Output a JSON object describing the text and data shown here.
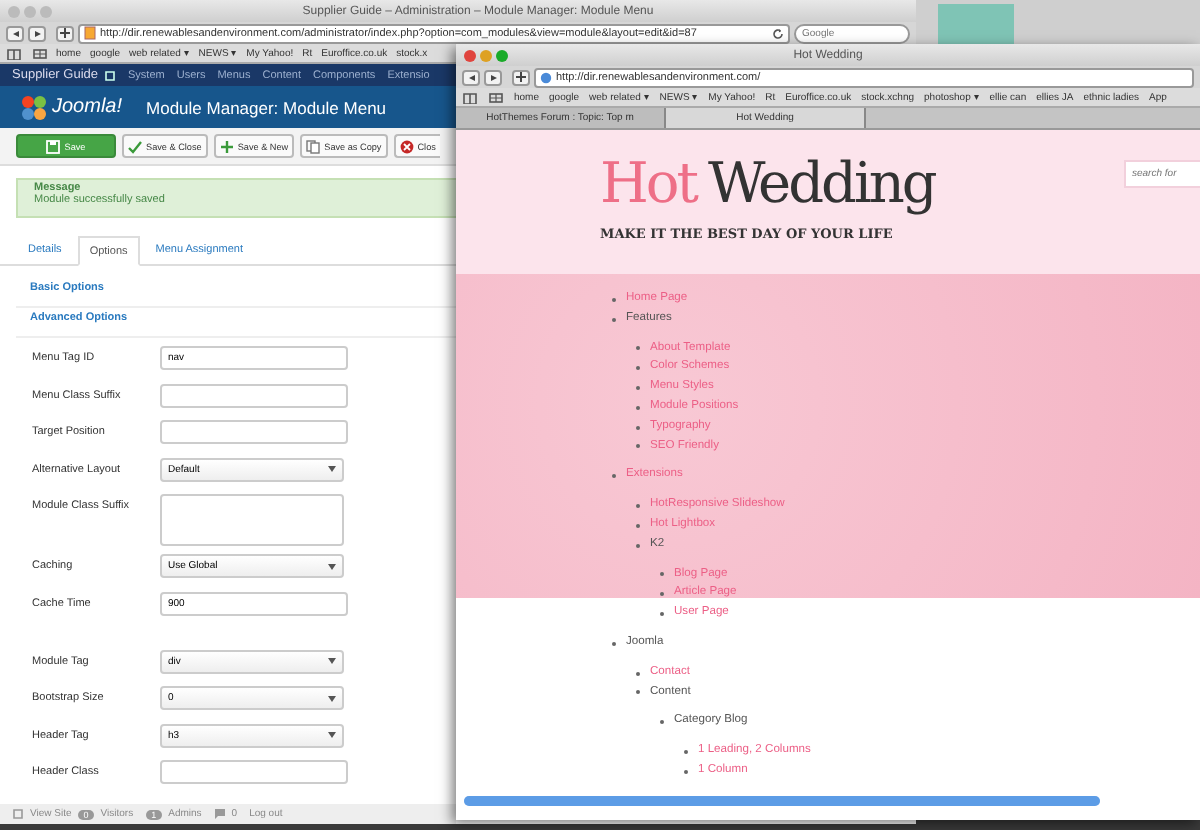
{
  "back_window": {
    "title": "Supplier Guide – Administration – Module Manager: Module Menu",
    "url": "http://dir.renewablesandenvironment.com/administrator/index.php?option=com_modules&view=module&layout=edit&id=87",
    "search_placeholder": "Google",
    "bookmarks": [
      "home",
      "google",
      "web related ▾",
      "NEWS ▾",
      "My Yahoo!",
      "Rt",
      "Euroffice.co.uk",
      "stock.x"
    ],
    "admin_nav": {
      "site": "Supplier Guide",
      "items": [
        "System",
        "Users",
        "Menus",
        "Content",
        "Components",
        "Extensio"
      ]
    },
    "header": {
      "title": "Module Manager: Module Menu",
      "logo": "Joomla!"
    },
    "toolbar": [
      {
        "label": "Save",
        "kind": "primary"
      },
      {
        "label": "Save & Close",
        "kind": "check"
      },
      {
        "label": "Save & New",
        "kind": "plus"
      },
      {
        "label": "Save as Copy",
        "kind": "copy"
      },
      {
        "label": "Clos",
        "kind": "close"
      }
    ],
    "message": {
      "title": "Message",
      "text": "Module successfully saved"
    },
    "tabs": [
      {
        "label": "Details",
        "selected": false
      },
      {
        "label": "Options",
        "selected": true
      },
      {
        "label": "Menu Assignment",
        "selected": false
      }
    ],
    "sections": [
      "Basic Options",
      "Advanced Options"
    ],
    "fields": [
      {
        "label": "Menu Tag ID",
        "kind": "text",
        "value": "nav"
      },
      {
        "label": "Menu Class Suffix",
        "kind": "text"
      },
      {
        "label": "Target Position",
        "kind": "text"
      },
      {
        "label": "Alternative Layout",
        "kind": "select",
        "value": "Default"
      },
      {
        "label": "Module Class Suffix",
        "kind": "textarea"
      },
      {
        "label": "Caching",
        "kind": "select",
        "value": "Use Global"
      },
      {
        "label": "Cache Time",
        "kind": "text",
        "value": "900"
      },
      {
        "label": "Module Tag",
        "kind": "select",
        "value": "div"
      },
      {
        "label": "Bootstrap Size",
        "kind": "select",
        "value": "0"
      },
      {
        "label": "Header Tag",
        "kind": "select",
        "value": "h3"
      },
      {
        "label": "Header Class",
        "kind": "text"
      }
    ],
    "status_bar": {
      "view_site": "View Site",
      "visitors_count": "0",
      "visitors": "Visitors",
      "admins_count": "1",
      "admins": "Admins",
      "logout_count": "0",
      "logout": "Log out"
    }
  },
  "front_window": {
    "title": "Hot Wedding",
    "url": "http://dir.renewablesandenvironment.com/",
    "bookmarks": [
      "home",
      "google",
      "web related ▾",
      "NEWS ▾",
      "My Yahoo!",
      "Rt",
      "Euroffice.co.uk",
      "stock.xchng",
      "photoshop ▾",
      "ellie can",
      "ellies JA",
      "ethnic ladies",
      "App"
    ],
    "tabs": [
      {
        "label": "HotThemes Forum : Topic: Top m",
        "selected": false
      },
      {
        "label": "Hot Wedding",
        "selected": true
      }
    ],
    "site": {
      "logo": [
        "Hot",
        "Wedding"
      ],
      "tagline": "MAKE IT THE BEST DAY OF YOUR LIFE",
      "search_placeholder": "search for",
      "menu": [
        {
          "label": "Home Page",
          "link": true
        },
        {
          "label": "Features",
          "link": false,
          "children": [
            {
              "label": "About Template",
              "link": true
            },
            {
              "label": "Color Schemes",
              "link": true
            },
            {
              "label": "Menu Styles",
              "link": true
            },
            {
              "label": "Module Positions",
              "link": true
            },
            {
              "label": "Typography",
              "link": true
            },
            {
              "label": "SEO Friendly",
              "link": true
            }
          ]
        },
        {
          "label": "Extensions",
          "link": true,
          "children": [
            {
              "label": "HotResponsive Slideshow",
              "link": true
            },
            {
              "label": "Hot Lightbox",
              "link": true
            },
            {
              "label": "K2",
              "link": false,
              "children": [
                {
                  "label": "Blog Page",
                  "link": true
                },
                {
                  "label": "Article Page",
                  "link": true
                },
                {
                  "label": "User Page",
                  "link": true
                }
              ]
            }
          ]
        },
        {
          "label": "Joomla",
          "link": false,
          "children": [
            {
              "label": "Contact",
              "link": true
            },
            {
              "label": "Content",
              "link": false,
              "children": [
                {
                  "label": "Category Blog",
                  "link": false,
                  "children": [
                    {
                      "label": "1 Leading, 2 Columns",
                      "link": true
                    },
                    {
                      "label": "1 Column",
                      "link": true
                    }
                  ]
                }
              ]
            }
          ]
        }
      ]
    }
  }
}
